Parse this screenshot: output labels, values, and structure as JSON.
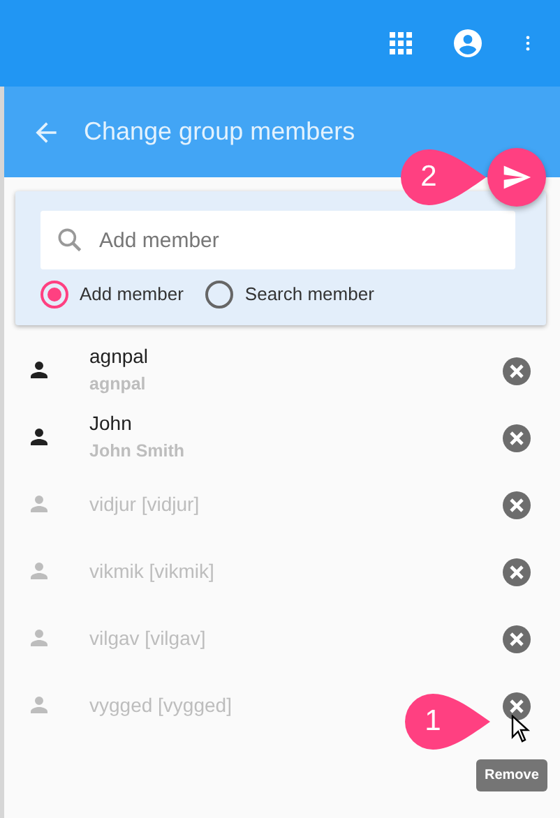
{
  "header": {
    "title": "Change group members"
  },
  "search": {
    "placeholder": "Add member"
  },
  "modes": [
    {
      "label": "Add member",
      "selected": true
    },
    {
      "label": "Search member",
      "selected": false
    }
  ],
  "members": [
    {
      "name": "agnpal",
      "subtitle": "agnpal",
      "active": true
    },
    {
      "name": "John",
      "subtitle": "John Smith",
      "active": true
    },
    {
      "name": "vidjur [vidjur]",
      "active": false
    },
    {
      "name": "vikmik [vikmik]",
      "active": false
    },
    {
      "name": "vilgav [vilgav]",
      "active": false
    },
    {
      "name": "vygged [vygged]",
      "active": false
    }
  ],
  "tooltip": "Remove",
  "callouts": [
    {
      "label": "2",
      "kind": "send"
    },
    {
      "label": "1",
      "kind": "remove"
    }
  ]
}
